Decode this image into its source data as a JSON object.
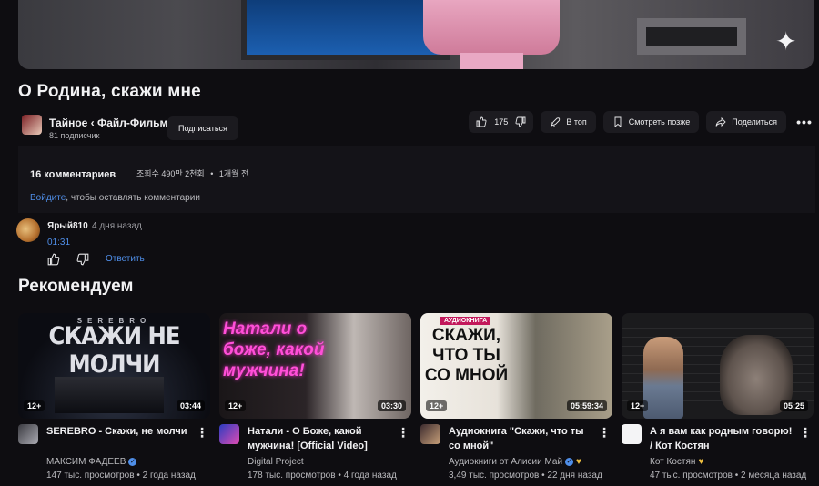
{
  "video": {
    "title": "О Родина, скажи мне",
    "channel_name": "Тайное ‹ Файл-Фильм",
    "channel_subs": "81 подписчик",
    "subscribe_label": "Подписаться",
    "likes": "175",
    "top_label": "В топ",
    "watch_later_label": "Смотреть позже",
    "share_label": "Поделиться",
    "more_label": "•••"
  },
  "description": {
    "comments_count": "16 комментариев",
    "views": "조회수 490만 2천회",
    "dot": "•",
    "date": "1개월 전",
    "login_link": "Войдите",
    "login_rest": ", чтобы оставлять комментарии"
  },
  "comment": {
    "author": "Ярый810",
    "time": "4 дня назад",
    "timestamp": "01:31",
    "reply_label": "Ответить"
  },
  "recommend": {
    "heading": "Рекомендуем",
    "cards": [
      {
        "thumb_text": "СКАЖИ НЕ МОЛЧИ",
        "thumb_top": "SEREBRO",
        "age": "12+",
        "duration": "03:44",
        "title": "SEREBRO - Скажи, не молчи",
        "author": "МАКСИМ ФАДЕЕВ",
        "stats": "147 тыс. просмотров • 2 года назад",
        "menu": "⋮"
      },
      {
        "thumb_text": "Натали о боже, какой мужчина!",
        "age": "12+",
        "duration": "03:30",
        "title": "Натали - О Боже, какой мужчина! [Official Video]",
        "author": "Digital Project",
        "stats": "178 тыс. просмотров • 4 года назад",
        "menu": "⋮"
      },
      {
        "thumb_label": "АУДИОКНИГА",
        "thumb_text": "СКАЖИ, ЧТО ТЫ СО МНОЙ",
        "age": "12+",
        "duration": "05:59:34",
        "title": "Аудиокнига \"Скажи, что ты со мной\"",
        "author": "Аудиокниги от Алисии Май",
        "stats": "3,49 тыс. просмотров • 22 дня назад",
        "menu": "⋮"
      },
      {
        "age": "12+",
        "duration": "05:25",
        "title": "А я вам как родным говорю! / Кот Костян",
        "author": "Кот Костян",
        "stats": "47 тыс. просмотров • 2 месяца назад",
        "menu": "⋮"
      }
    ]
  },
  "colors": {
    "background": "#0e0d11",
    "link": "#4f8ee8",
    "card_bg": "#1c1b20"
  }
}
